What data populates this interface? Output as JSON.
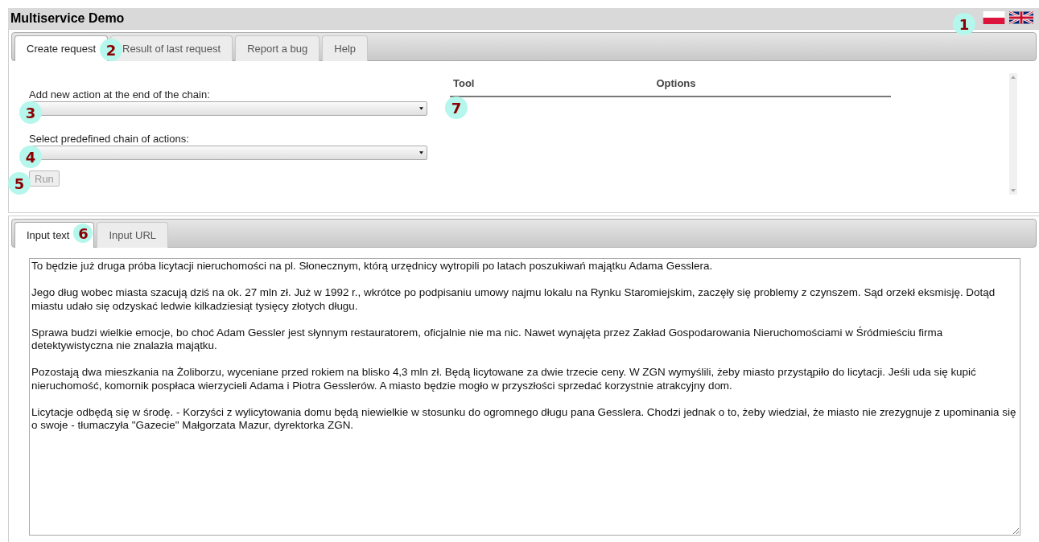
{
  "app": {
    "title": "Multiservice Demo"
  },
  "languages": {
    "callout": "1",
    "flags": [
      {
        "kind": "pl"
      },
      {
        "kind": "gb"
      }
    ]
  },
  "request_tabs": [
    {
      "label": "Create request",
      "selected": true,
      "callout": "2"
    },
    {
      "label": "Result of last request",
      "selected": false
    },
    {
      "label": "Report a bug",
      "selected": false
    },
    {
      "label": "Help",
      "selected": false
    }
  ],
  "form": {
    "action_select": {
      "label": "Add new action at the end of the chain:",
      "callout": "3"
    },
    "chain_select": {
      "label": "Select predefined chain of actions:",
      "callout": "4"
    },
    "run_button": {
      "label": "Run",
      "disabled": true,
      "callout": "5"
    }
  },
  "chain_table": {
    "columns": [
      "Tool",
      "Options"
    ],
    "callout": "7"
  },
  "input_tabs": [
    {
      "label": "Input text",
      "selected": true,
      "callout": "6"
    },
    {
      "label": "Input URL",
      "selected": false
    }
  ],
  "input_text": {
    "value": "To będzie już druga próba licytacji nieruchomości na pl. Słonecznym, którą urzędnicy wytropili po latach poszukiwań majątku Adama Gesslera.\n\nJego dług wobec miasta szacują dziś na ok. 27 mln zł. Już w 1992 r., wkrótce po podpisaniu umowy najmu lokalu na Rynku Staromiejskim, zaczęły się problemy z czynszem. Sąd orzekł eksmisję. Dotąd miastu udało się odzyskać ledwie kilkadziesiąt tysięcy złotych długu.\n\nSprawa budzi wielkie emocje, bo choć Adam Gessler jest słynnym restauratorem, oficjalnie nie ma nic. Nawet wynajęta przez Zakład Gospodarowania Nieruchomościami w Śródmieściu firma detektywistyczna nie znalazła majątku.\n\nPozostają dwa mieszkania na Żoliborzu, wyceniane przed rokiem na blisko 4,3 mln zł. Będą licytowane za dwie trzecie ceny. W ZGN wymyślili, żeby miasto przystąpiło do licytacji. Jeśli uda się kupić nieruchomość, komornik pospłaca wierzycieli Adama i Piotra Gesslerów. A miasto będzie mogło w przyszłości sprzedać korzystnie atrakcyjny dom.\n\nLicytacje odbędą się w środę. - Korzyści z wylicytowania domu będą niewielkie w stosunku do ogromnego długu pana Gesslera. Chodzi jednak o to, żeby wiedział, że miasto nie zrezygnuje z upominania się o swoje - tłumaczyła \"Gazecie\" Małgorzata Mazur, dyrektorka ZGN."
  }
}
